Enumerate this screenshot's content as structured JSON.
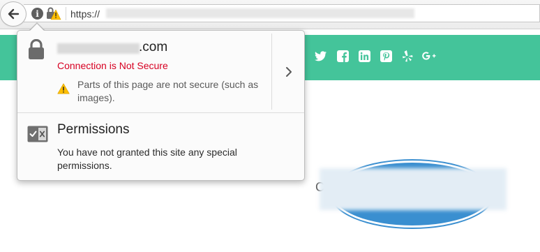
{
  "urlbar": {
    "scheme_text": "https://"
  },
  "identity_panel": {
    "domain_suffix": ".com",
    "connection_status": "Connection is Not Secure",
    "mixed_content_text": "Parts of this page are not secure (such as images).",
    "permissions_title": "Permissions",
    "permissions_text": "You have not granted this site any special permissions."
  },
  "colors": {
    "insecure_red": "#d70022",
    "header_green": "#44c49a",
    "warning_yellow": "#ffbf00",
    "logo_blue": "#3a8fd0"
  },
  "icons": {
    "back": "back-arrow-icon",
    "info": "info-icon",
    "lock_warning": "lock-warning-icon",
    "lock": "lock-icon",
    "warning": "warning-icon",
    "chevron": "chevron-right-icon",
    "permissions": "permissions-icon",
    "social": [
      "twitter-icon",
      "facebook-icon",
      "linkedin-icon",
      "pinterest-icon",
      "yelp-icon",
      "google-plus-icon"
    ]
  }
}
